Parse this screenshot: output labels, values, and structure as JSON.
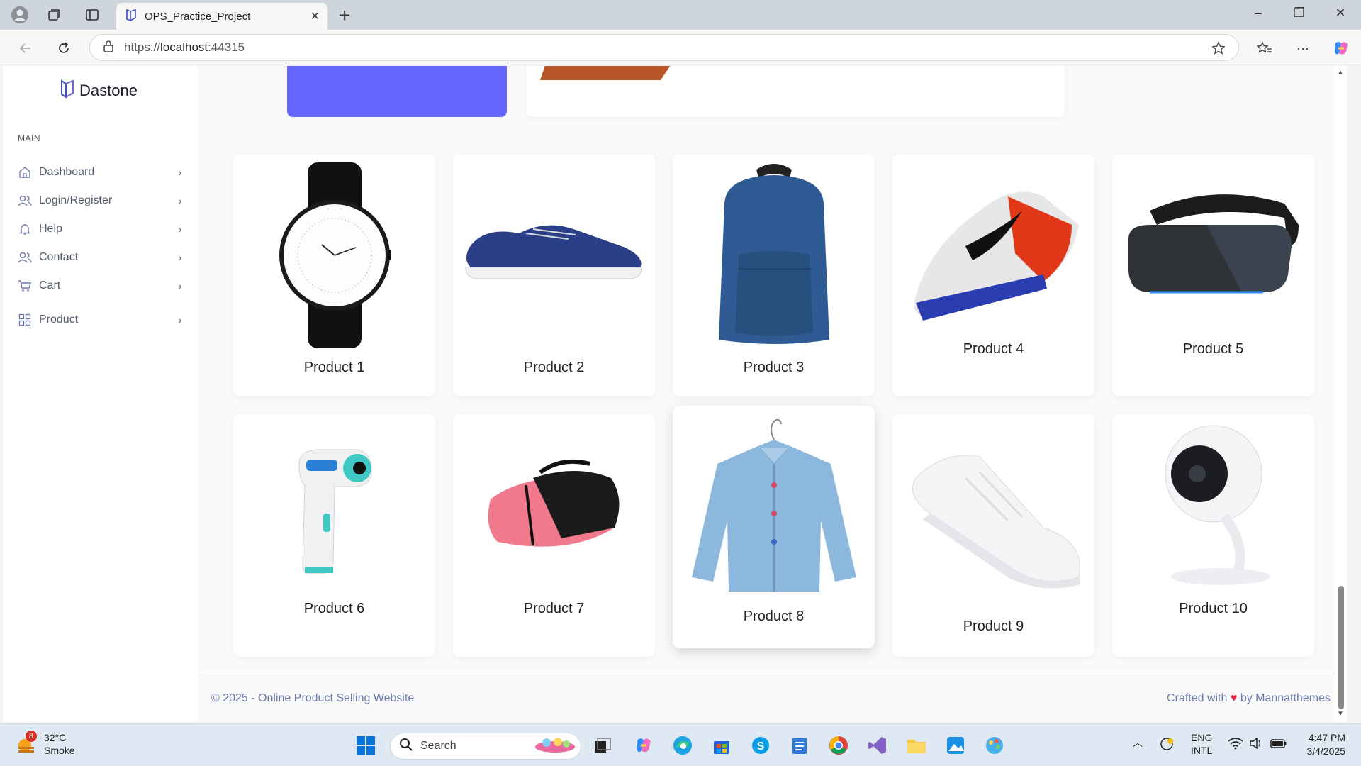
{
  "browser": {
    "tab_title": "OPS_Practice_Project",
    "url_prefix": "https://",
    "url_host": "localhost",
    "url_port": ":44315"
  },
  "sidebar": {
    "brand": "Dastone",
    "section": "MAIN",
    "items": [
      {
        "label": "Dashboard",
        "icon": "home-icon"
      },
      {
        "label": "Login/Register",
        "icon": "users-icon"
      },
      {
        "label": "Help",
        "icon": "bell-icon"
      },
      {
        "label": "Contact",
        "icon": "users-icon"
      },
      {
        "label": "Cart",
        "icon": "cart-icon"
      },
      {
        "label": "Product",
        "icon": "grid-icon"
      }
    ]
  },
  "products": [
    {
      "name": "Product 1",
      "icon": "watch"
    },
    {
      "name": "Product 2",
      "icon": "sneaker"
    },
    {
      "name": "Product 3",
      "icon": "backpack"
    },
    {
      "name": "Product 4",
      "icon": "running-shoe"
    },
    {
      "name": "Product 5",
      "icon": "vr-headset"
    },
    {
      "name": "Product 6",
      "icon": "thermometer"
    },
    {
      "name": "Product 7",
      "icon": "duffel-bag"
    },
    {
      "name": "Product 8",
      "icon": "denim-shirt"
    },
    {
      "name": "Product 9",
      "icon": "white-sneaker"
    },
    {
      "name": "Product 10",
      "icon": "security-camera"
    }
  ],
  "footer": {
    "left": "© 2025 - Online Product Selling Website",
    "right_prefix": "Crafted with",
    "right_suffix": "by Mannatthemes"
  },
  "taskbar": {
    "weather_badge": "8",
    "temperature": "32°C",
    "condition": "Smoke",
    "search_label": "Search",
    "language_1": "ENG",
    "language_2": "INTL",
    "time": "4:47 PM",
    "date": "3/4/2025"
  },
  "colors": {
    "accent": "#6464ff",
    "footer_text": "#6f7bb0",
    "heart": "#e6244a"
  }
}
